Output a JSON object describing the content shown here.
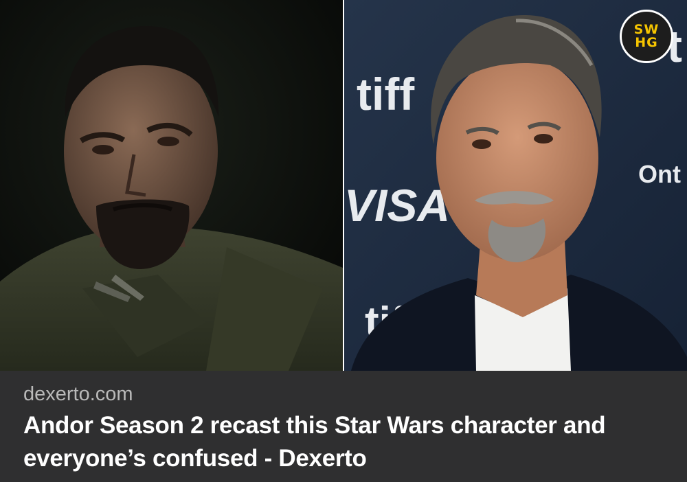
{
  "logo": {
    "text": "SW\nHG",
    "accent": "#f5c400"
  },
  "backdrop": {
    "brand_tiff": "tiff",
    "brand_visa": "VISA",
    "brand_ont": "Ont",
    "brand_t": "t"
  },
  "caption": {
    "source": "dexerto.com",
    "headline": "Andor Season 2 recast this Star Wars character and everyone’s confused  - Dexerto"
  },
  "colors": {
    "caption_bg": "#2f2f30",
    "source_text": "#b9b9b9",
    "headline_text": "#ffffff",
    "backdrop_blue": "#1c2a3e"
  }
}
